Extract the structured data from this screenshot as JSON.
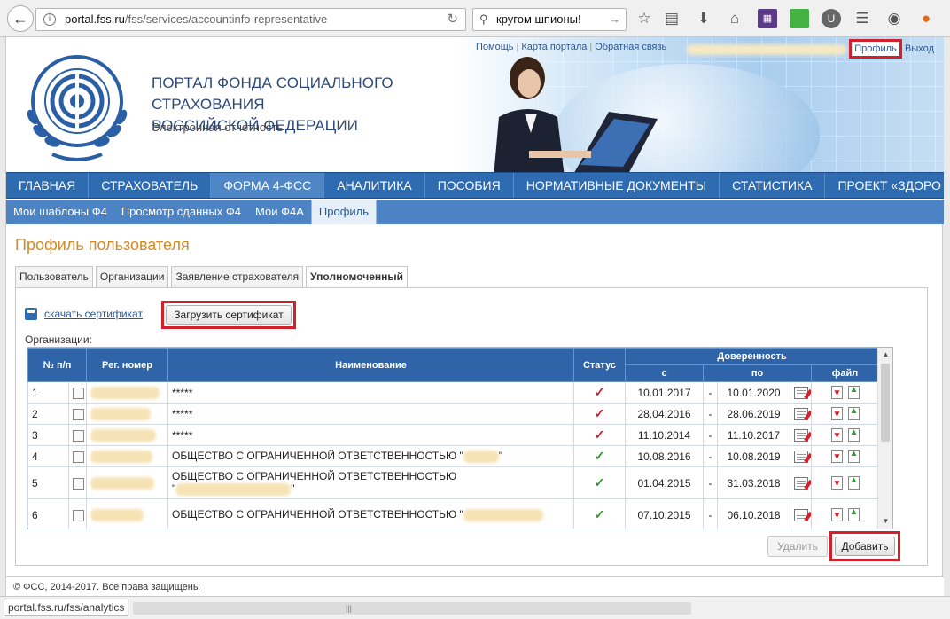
{
  "browser": {
    "url_domain": "portal.fss.ru",
    "url_path": "/fss/services/accountinfo-representative",
    "search_query": "кругом шпионы!",
    "status_url": "portal.fss.ru/fss/analytics"
  },
  "header": {
    "title_line1": "ПОРТАЛ ФОНДА СОЦИАЛЬНОГО СТРАХОВАНИЯ",
    "title_line2": "РОССИЙСКОЙ ФЕДЕРАЦИИ",
    "subtitle": "Электронная отчетность",
    "links": [
      "Помощь",
      "Карта портала",
      "Обратная связь"
    ],
    "profile_link": "Профиль",
    "exit_link": "Выход"
  },
  "main_nav": [
    {
      "label": "ГЛАВНАЯ",
      "active": false
    },
    {
      "label": "СТРАХОВАТЕЛЬ",
      "active": false
    },
    {
      "label": "ФОРМА 4-ФСС",
      "active": true
    },
    {
      "label": "АНАЛИТИКА",
      "active": false
    },
    {
      "label": "ПОСОБИЯ",
      "active": false
    },
    {
      "label": "НОРМАТИВНЫЕ ДОКУМЕНТЫ",
      "active": false
    },
    {
      "label": "СТАТИСТИКА",
      "active": false
    },
    {
      "label": "ПРОЕКТ «ЗДОРО",
      "active": false
    }
  ],
  "sub_nav": [
    {
      "label": "Мои шаблоны Ф4",
      "active": false
    },
    {
      "label": "Просмотр сданных Ф4",
      "active": false
    },
    {
      "label": "Мои Ф4А",
      "active": false
    },
    {
      "label": "Профиль",
      "active": true
    }
  ],
  "content": {
    "title": "Профиль пользователя",
    "tabs": [
      "Пользователь",
      "Организации",
      "Заявление страхователя",
      "Уполномоченный"
    ],
    "download_cert": "скачать сертификат",
    "upload_cert": "Загрузить сертификат",
    "orgs_label": "Организации:"
  },
  "table": {
    "headers": {
      "num": "№ п/п",
      "reg": "Рег. номер",
      "name": "Наименование",
      "status": "Статус",
      "proxy": "Доверенность",
      "from": "с",
      "to": "по",
      "file": "файл"
    },
    "rows": [
      {
        "num": "1",
        "name": "*****",
        "status": "invalid",
        "from": "10.01.2017",
        "dash": "-",
        "to": "10.01.2020"
      },
      {
        "num": "2",
        "name": "*****",
        "status": "invalid",
        "from": "28.04.2016",
        "dash": "-",
        "to": "28.06.2019"
      },
      {
        "num": "3",
        "name": "*****",
        "status": "invalid",
        "from": "11.10.2014",
        "dash": "-",
        "to": "11.10.2017"
      },
      {
        "num": "4",
        "name": "ОБЩЕСТВО С ОГРАНИЧЕННОЙ ОТВЕТСТВЕННОСТЬЮ \"",
        "status": "valid",
        "from": "10.08.2016",
        "dash": "-",
        "to": "10.08.2019"
      },
      {
        "num": "5",
        "name": "ОБЩЕСТВО С ОГРАНИЧЕННОЙ ОТВЕТСТВЕННОСТЬЮ",
        "status": "valid",
        "from": "01.04.2015",
        "dash": "-",
        "to": "31.03.2018"
      },
      {
        "num": "6",
        "name": "ОБЩЕСТВО С ОГРАНИЧЕННОЙ ОТВЕТСТВЕННОСТЬЮ \"",
        "status": "valid",
        "from": "07.10.2015",
        "dash": "-",
        "to": "06.10.2018"
      }
    ],
    "status_symbol": "✓"
  },
  "buttons": {
    "delete": "Удалить",
    "add": "Добавить"
  },
  "footer": "© ФСС, 2014-2017. Все права защищены",
  "colors": {
    "nav_blue": "#2f6bb0",
    "title_orange": "#d28a24",
    "highlight_red": "#d3202b",
    "status_red": "#d3202b",
    "status_green": "#2f9a2f"
  }
}
